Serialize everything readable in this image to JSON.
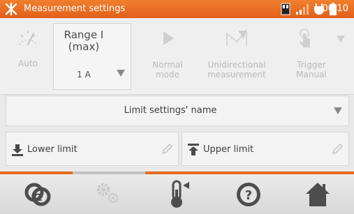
{
  "statusbar": {
    "title": "Measurement settings",
    "time": "06:10"
  },
  "toolbar": {
    "auto_label": "Auto",
    "range_title_line1": "Range I",
    "range_title_line2": "(max)",
    "range_value": "1 A",
    "normal_mode_line1": "Normal",
    "normal_mode_line2": "mode",
    "unidirectional_line1": "Unidirectional",
    "unidirectional_line2": "measurement",
    "trigger_line1": "Trigger",
    "trigger_line2": "Manual"
  },
  "limits": {
    "name_label": "Limit settings' name",
    "lower_label": "Lower limit",
    "upper_label": "Upper limit"
  },
  "colors": {
    "accent": "#e66a20",
    "disabled": "#b9b9b9",
    "icon_dark": "#555555"
  }
}
